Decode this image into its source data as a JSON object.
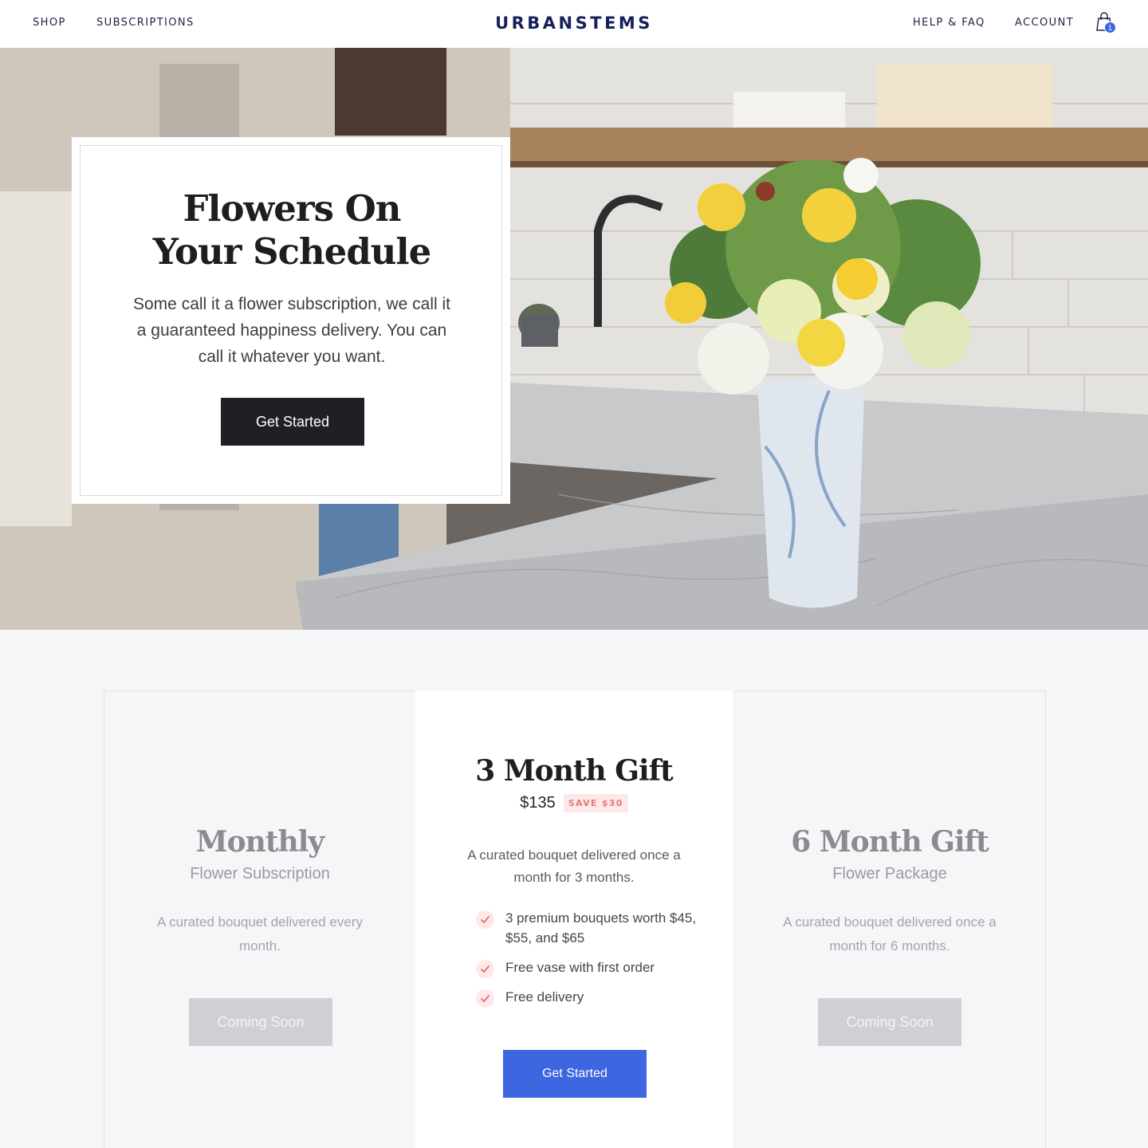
{
  "header": {
    "nav_left": [
      "SHOP",
      "SUBSCRIPTIONS"
    ],
    "logo": "URBANSTEMS",
    "nav_right": [
      "HELP & FAQ",
      "ACCOUNT"
    ],
    "cart_count": "1",
    "cart_icon": "shopping-bag-icon"
  },
  "hero": {
    "title_line1": "Flowers On",
    "title_line2": "Your Schedule",
    "text": "Some call it a flower subscription, we call it a guaranteed happiness delivery. You can call it whatever you want.",
    "button": "Get Started"
  },
  "plans": {
    "monthly": {
      "name": "Monthly",
      "subtitle": "Flower Subscription",
      "description": "A curated bouquet delivered every month.",
      "button": "Coming Soon"
    },
    "three_month": {
      "name": "3 Month Gift",
      "price": "$135",
      "badge": "SAVE $30",
      "description": "A curated bouquet delivered once a month for 3 months.",
      "features": [
        "3 premium bouquets worth $45, $55, and $65",
        "Free vase with first order",
        "Free delivery"
      ],
      "button": "Get Started"
    },
    "six_month": {
      "name": "6 Month Gift",
      "subtitle": "Flower Package",
      "description": "A curated bouquet delivered once a month for 6 months.",
      "button": "Coming Soon"
    }
  },
  "colors": {
    "accent": "#3d66e0",
    "logo": "#15205a",
    "badge_text": "#e67a7a",
    "badge_bg": "#fde9e9"
  }
}
